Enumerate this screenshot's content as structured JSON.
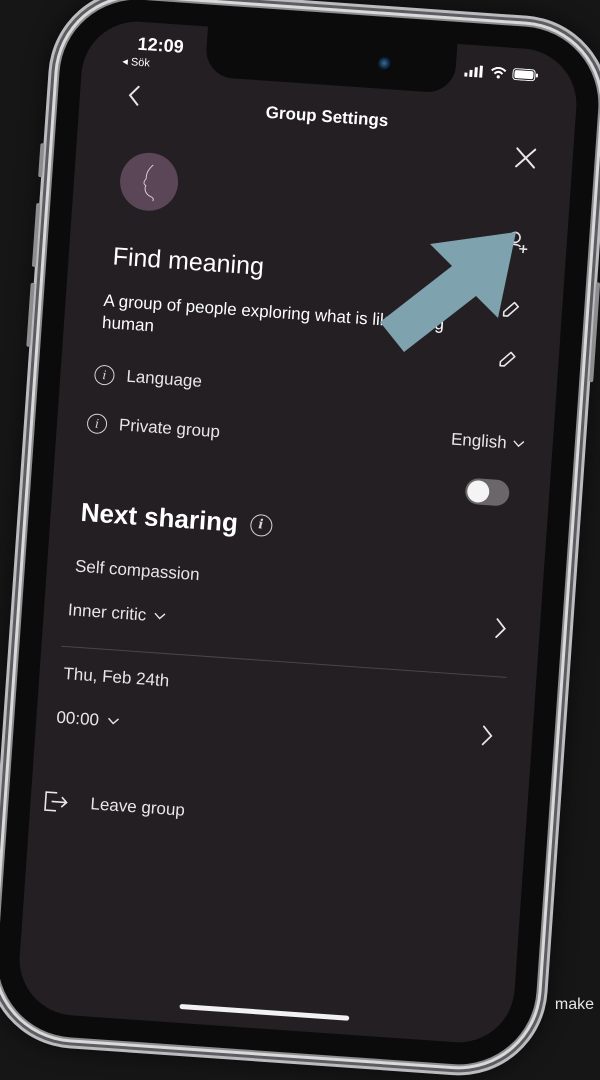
{
  "status_bar": {
    "time": "12:09",
    "back_label": "◂ Sök"
  },
  "header": {
    "title": "Group Settings"
  },
  "group": {
    "name": "Find meaning",
    "description": "A group of people exploring what is like being human"
  },
  "settings": {
    "language_label": "Language",
    "language_value": "English",
    "private_label": "Private group",
    "private_enabled": false
  },
  "next_sharing": {
    "title": "Next sharing",
    "topic": "Self compassion",
    "subtopic": "Inner critic",
    "date": "Thu, Feb 24th",
    "time": "00:00"
  },
  "actions": {
    "leave_group": "Leave group"
  },
  "overlay": {
    "trailing_text": "make",
    "arrow_color": "#7ea2ae"
  },
  "colors": {
    "screen_background": "#231f22",
    "avatar_background": "#5a4656",
    "page_background": "#161616"
  }
}
